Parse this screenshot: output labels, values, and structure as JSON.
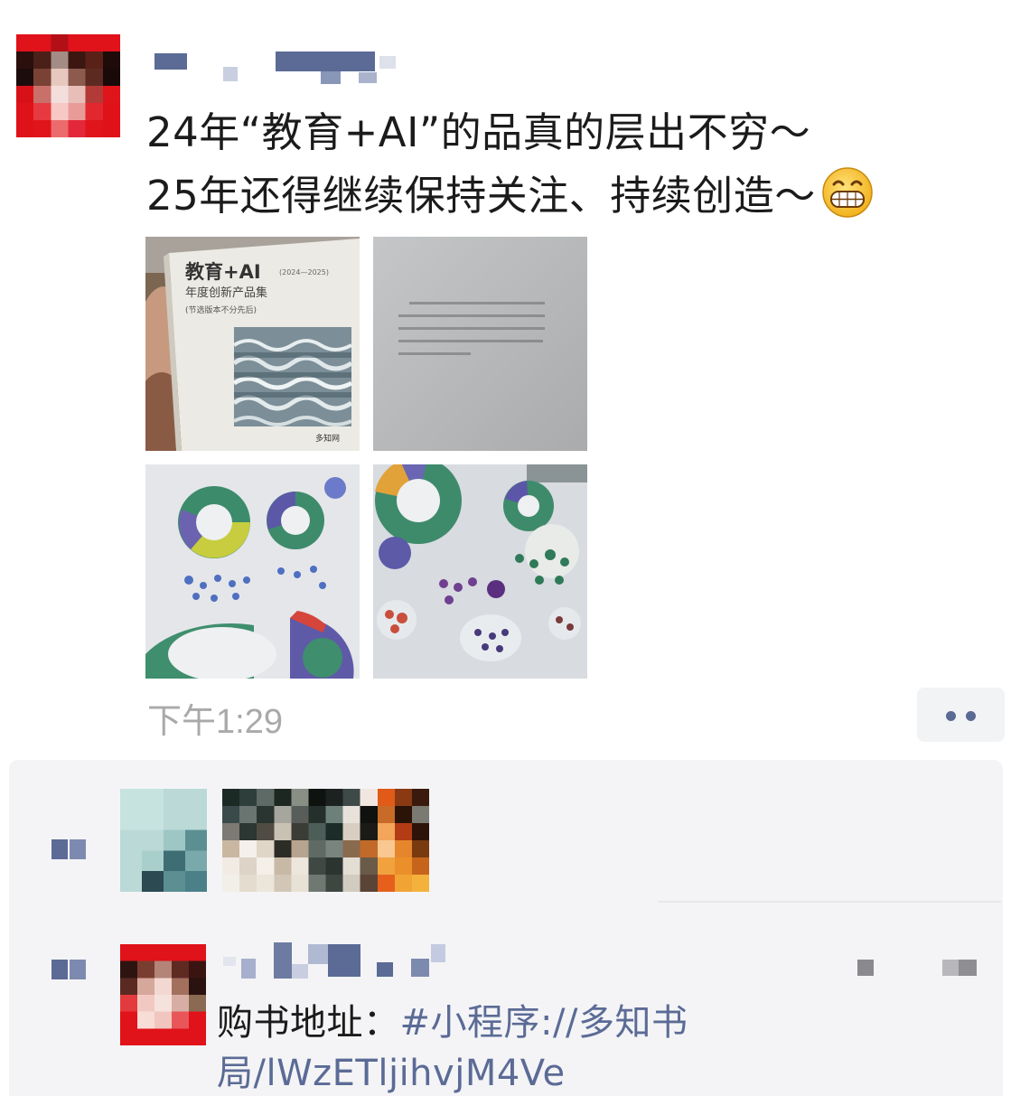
{
  "post": {
    "text_line1": "24年“教育+AI”的品真的层出不穷～",
    "text_line2": "25年还得继续保持关注、持续创造～",
    "emoji": "grin-emoji",
    "time": "下午1:29",
    "photos": [
      {
        "id": "photo-1",
        "description_icon": "book-cover-photo",
        "cover_title": "教育+AI",
        "cover_years": "(2024—2025)",
        "cover_subtitle": "年度创新产品集",
        "cover_note": "(节选版本不分先后)",
        "cover_publisher": "多知网"
      },
      {
        "id": "photo-2",
        "description_icon": "book-page-photo"
      },
      {
        "id": "photo-3",
        "description_icon": "chart-page-photo"
      },
      {
        "id": "photo-4",
        "description_icon": "chart-page-photo"
      }
    ]
  },
  "actions": {
    "more_icon": "more-dots-icon"
  },
  "interactions": {
    "likes_icon": "like-icon",
    "comment_icon": "comment-icon",
    "comment": {
      "prefix": "购书地址：",
      "link": "#小程序://多知书局/lWzETljihvjM4Ve"
    }
  },
  "colors": {
    "link": "#5b6b96",
    "time": "#a9a9a9",
    "panel": "#f4f4f6"
  }
}
